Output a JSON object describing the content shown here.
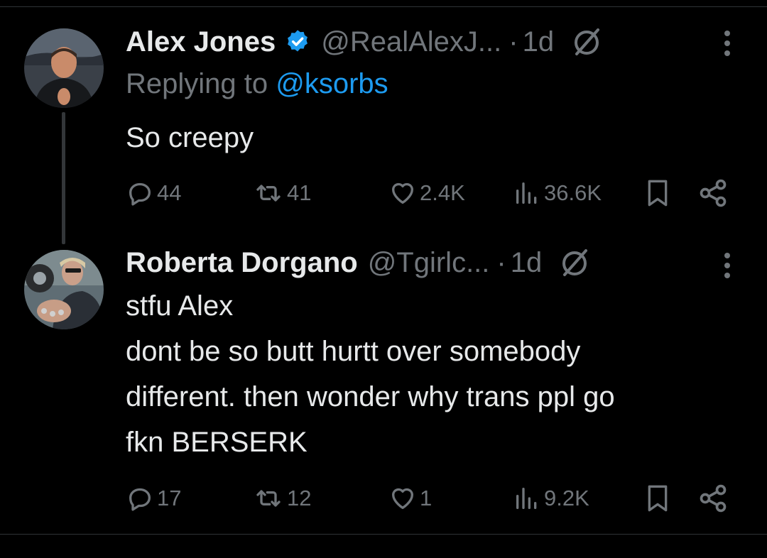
{
  "tweets": [
    {
      "display_name": "Alex Jones",
      "handle": "@RealAlexJ...",
      "separator": "·",
      "time": "1d",
      "reply_prefix": "Replying to ",
      "reply_mention": "@ksorbs",
      "lines": [
        "So creepy"
      ],
      "replies": "44",
      "reposts": "41",
      "likes": "2.4K",
      "views": "36.6K",
      "verified": true
    },
    {
      "display_name": "Roberta Dorgano",
      "handle": "@Tgirlc...",
      "separator": "·",
      "time": "1d",
      "lines": [
        "stfu Alex",
        "dont be so butt hurtt over somebody",
        "different. then wonder why trans ppl go",
        "fkn BERSERK"
      ],
      "replies": "17",
      "reposts": "12",
      "likes": "1",
      "views": "9.2K",
      "verified": false
    }
  ],
  "colors": {
    "background": "#000000",
    "text": "#e7e9ea",
    "muted": "#71767b",
    "accent": "#1d9bf0",
    "divider": "#2f3336"
  },
  "icons": [
    "verified-badge-icon",
    "grok-icon",
    "more-icon",
    "reply-icon",
    "repost-icon",
    "like-icon",
    "views-icon",
    "bookmark-icon",
    "share-icon"
  ]
}
